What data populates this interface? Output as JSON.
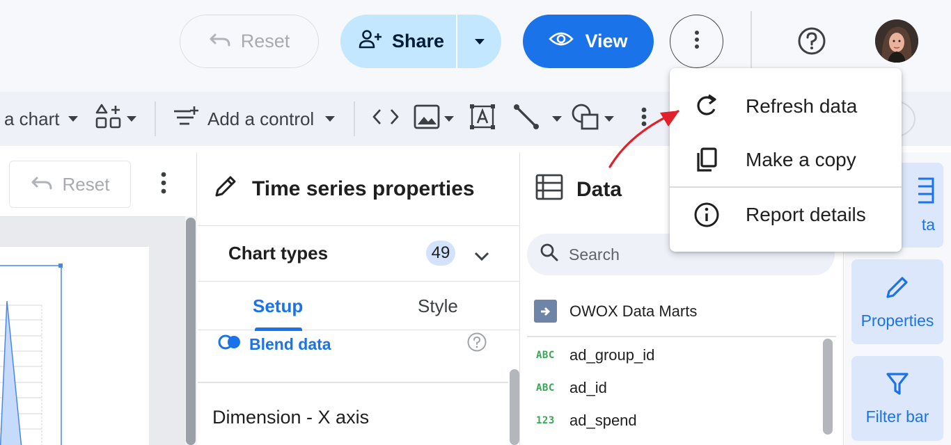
{
  "header": {
    "reset_label": "Reset",
    "share_label": "Share",
    "view_label": "View"
  },
  "toolbar": {
    "add_chart_label": "a chart",
    "add_control_label": "Add a control"
  },
  "left_panel": {
    "reset_label": "Reset"
  },
  "properties": {
    "title": "Time series properties",
    "chart_types_label": "Chart types",
    "chart_types_count": "49",
    "tabs": [
      {
        "label": "Setup",
        "active": true
      },
      {
        "label": "Style",
        "active": false
      }
    ],
    "blend_label": "Blend data",
    "dimension_title": "Dimension - X axis"
  },
  "data_panel": {
    "title": "Data",
    "search_placeholder": "Search",
    "source_name": "OWOX Data Marts",
    "fields": [
      {
        "type": "ABC",
        "name": "ad_group_id"
      },
      {
        "type": "ABC",
        "name": "ad_id"
      },
      {
        "type": "123",
        "name": "ad_spend"
      }
    ]
  },
  "rail": {
    "items": [
      {
        "label": "ta",
        "icon": "table-icon"
      },
      {
        "label": "Properties",
        "icon": "pencil-icon"
      },
      {
        "label": "Filter bar",
        "icon": "filter-icon"
      }
    ]
  },
  "menu": {
    "items": [
      {
        "label": "Refresh data",
        "icon": "refresh-icon"
      },
      {
        "label": "Make a copy",
        "icon": "copy-icon"
      },
      {
        "label": "Report details",
        "icon": "info-icon"
      }
    ]
  },
  "colors": {
    "accent": "#1a73e8",
    "share_bg": "#c2e7ff",
    "annotation_arrow": "#e0202a",
    "field_type": "#34a853"
  }
}
